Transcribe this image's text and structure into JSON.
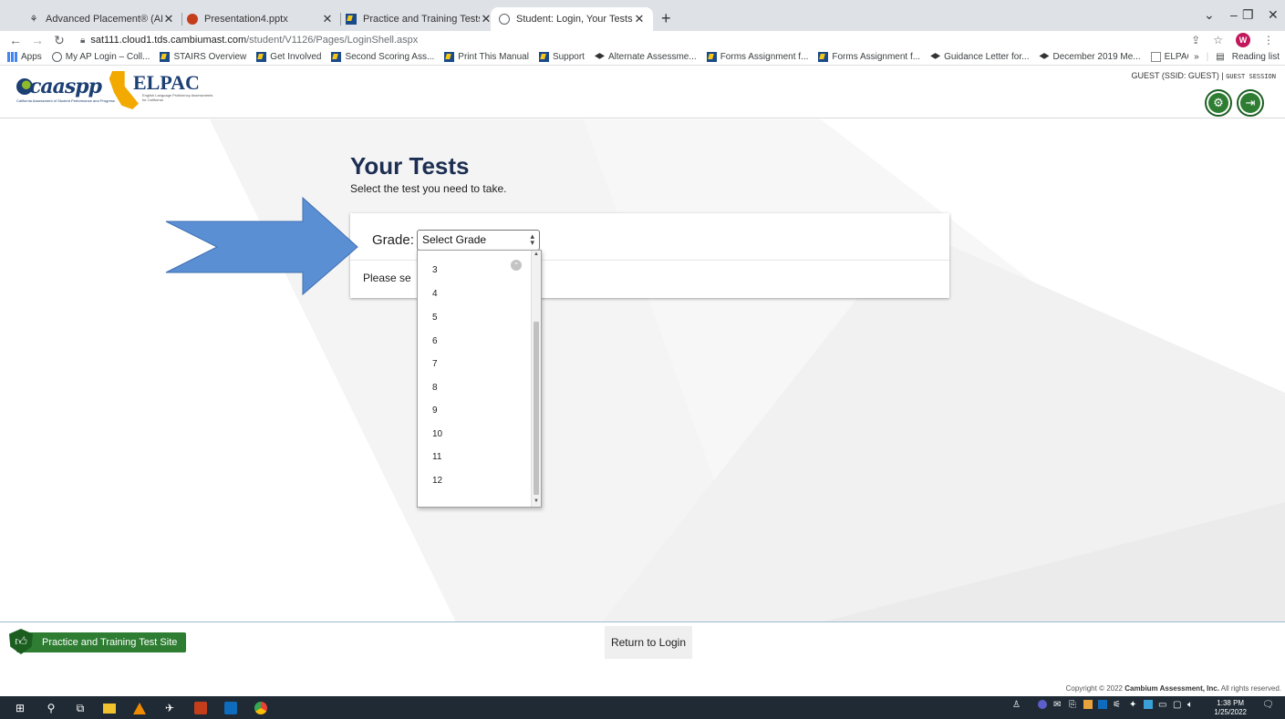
{
  "browser": {
    "tabs": [
      {
        "title": "Advanced Placement® (AP) – Th",
        "icon": "ap-icon"
      },
      {
        "title": "Presentation4.pptx",
        "icon": "powerpoint-icon"
      },
      {
        "title": "Practice and Training Tests",
        "icon": "tds-icon"
      },
      {
        "title": "Student: Login, Your Tests",
        "icon": "globe-icon"
      }
    ],
    "new_tab": "+",
    "url_host": "sat111.cloud1.tds.cambiumast.com",
    "url_path": "/student/V1126/Pages/LoginShell.aspx",
    "profile_initial": "W",
    "bookmarks": [
      {
        "label": "Apps",
        "icon": "grid"
      },
      {
        "label": "My AP Login – Coll...",
        "icon": "globe"
      },
      {
        "label": "STAIRS Overview",
        "icon": "tds"
      },
      {
        "label": "Get Involved",
        "icon": "tds"
      },
      {
        "label": "Second Scoring Ass...",
        "icon": "tds"
      },
      {
        "label": "Print This Manual",
        "icon": "tds"
      },
      {
        "label": "Support",
        "icon": "tds"
      },
      {
        "label": "Alternate Assessme...",
        "icon": "cap"
      },
      {
        "label": "Forms Assignment f...",
        "icon": "tds"
      },
      {
        "label": "Forms Assignment f...",
        "icon": "tds"
      },
      {
        "label": "Guidance Letter for...",
        "icon": "cap"
      },
      {
        "label": "December 2019 Me...",
        "icon": "cap"
      },
      {
        "label": "ELPAC Starting Sma...",
        "icon": "doc"
      }
    ],
    "bookmarks_more": "»",
    "reading_list": "Reading list"
  },
  "header": {
    "caaspp_logo": "caaspp",
    "caaspp_sub": "California Assessment of Student Performance and Progress",
    "elpac_logo": "ELPAC",
    "elpac_sub": "English Language Proficiency Assessments for California",
    "guest_text": "GUEST (SSID: GUEST) |",
    "guest_session": "GUEST SESSION"
  },
  "main": {
    "title": "Your Tests",
    "subtitle": "Select the test you need to take.",
    "grade_label": "Grade:",
    "grade_selected": "Select Grade",
    "please_text": "Please se",
    "grade_options": [
      "3",
      "4",
      "5",
      "6",
      "7",
      "8",
      "9",
      "10",
      "11",
      "12"
    ]
  },
  "footer": {
    "practice_site": "Practice and Training Test Site",
    "return_button": "Return to Login",
    "copyright_prefix": "Copyright © 2022",
    "copyright_company": "Cambium Assessment, Inc.",
    "copyright_suffix": "All rights reserved."
  },
  "taskbar": {
    "time": "1:38 PM",
    "date": "1/25/2022"
  },
  "colors": {
    "title_navy": "#1c2e52",
    "header_green": "#2e7d32",
    "arrow_blue": "#5b8fd4"
  }
}
